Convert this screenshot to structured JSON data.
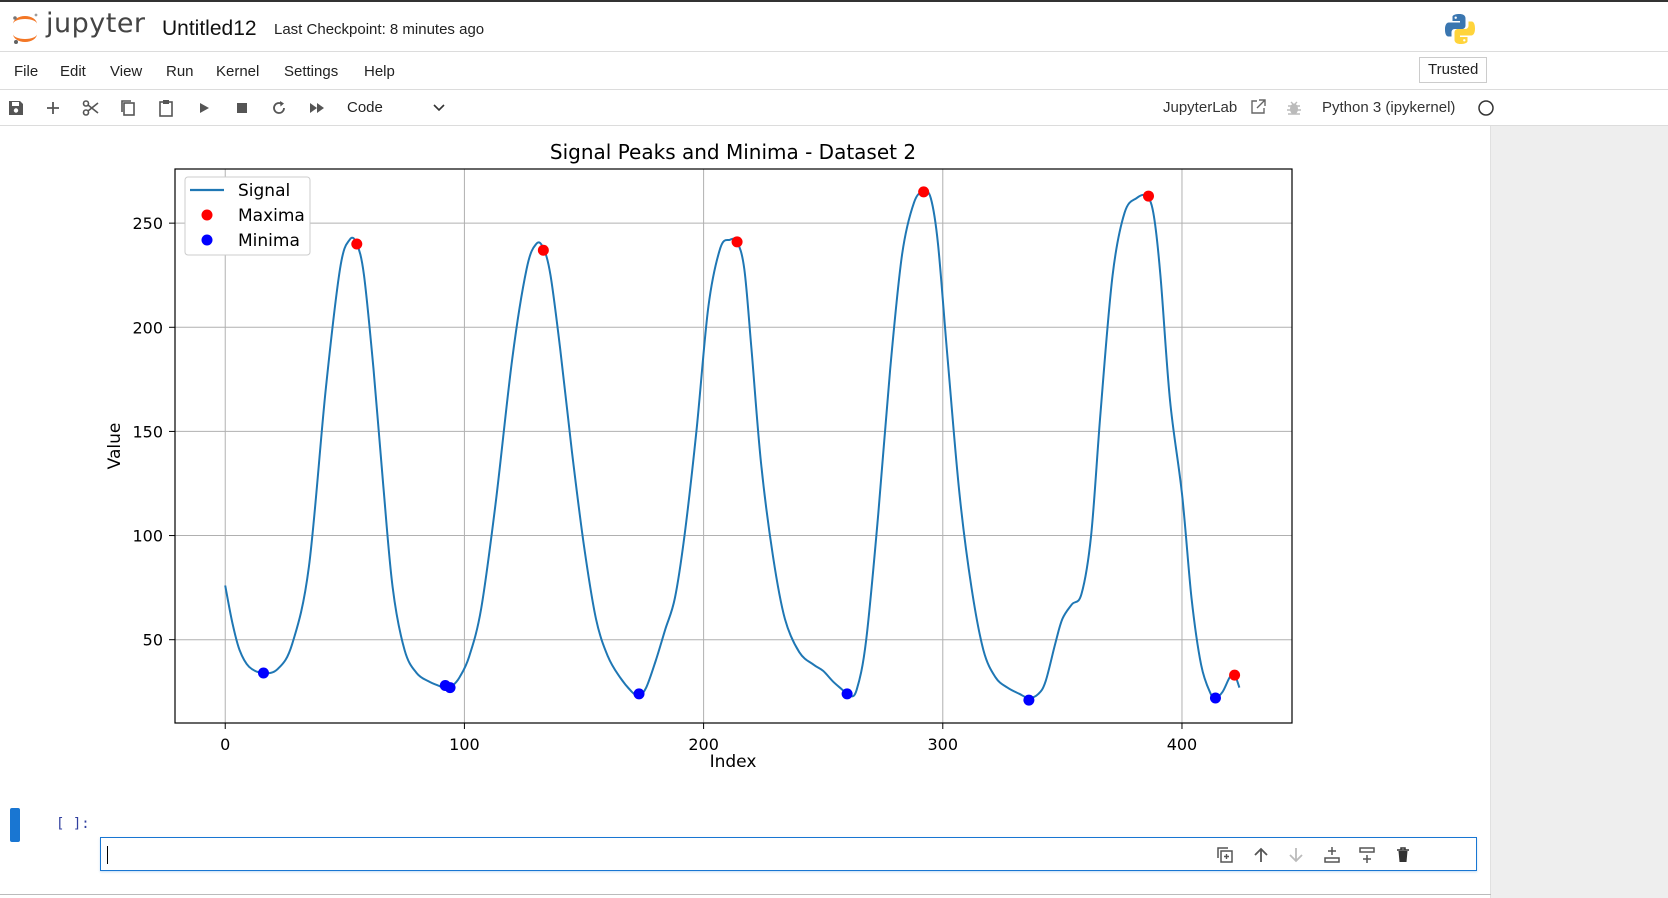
{
  "header": {
    "logo_text": "jupyter",
    "notebook_title": "Untitled12",
    "checkpoint": "Last Checkpoint: 8 minutes ago"
  },
  "menu": {
    "items": [
      "File",
      "Edit",
      "View",
      "Run",
      "Kernel",
      "Settings",
      "Help"
    ],
    "trusted": "Trusted"
  },
  "toolbar": {
    "buttons": [
      "save-icon",
      "add-icon",
      "cut-icon",
      "copy-icon",
      "paste-icon",
      "run-icon",
      "stop-icon",
      "restart-icon",
      "fast-forward-icon"
    ],
    "cell_type": "Code",
    "jupyterlab_link": "JupyterLab",
    "kernel": "Python 3 (ipykernel)"
  },
  "cell": {
    "prompt": "[ ]:",
    "value": ""
  },
  "chart_data": {
    "type": "line",
    "title": "Signal Peaks and Minima - Dataset 2",
    "xlabel": "Index",
    "ylabel": "Value",
    "xlim": [
      -21,
      446
    ],
    "ylim": [
      10,
      276
    ],
    "xticks": [
      0,
      100,
      200,
      300,
      400
    ],
    "yticks": [
      50,
      100,
      150,
      200,
      250
    ],
    "grid": true,
    "legend_position": "upper left",
    "colors": {
      "signal": "#1f77b4",
      "maxima": "#ff0000",
      "minima": "#0000ff"
    },
    "series": [
      {
        "name": "Signal",
        "kind": "line",
        "x": [
          0,
          3,
          6,
          10,
          16,
          22,
          28,
          35,
          42,
          48,
          52,
          55,
          58,
          62,
          66,
          70,
          75,
          80,
          85,
          89,
          92,
          95,
          98,
          102,
          107,
          113,
          120,
          126,
          130,
          133,
          136,
          140,
          145,
          150,
          155,
          160,
          165,
          170,
          173,
          176,
          180,
          184,
          188,
          192,
          197,
          202,
          207,
          211,
          214,
          217,
          220,
          224,
          229,
          234,
          240,
          246,
          250,
          254,
          258,
          261,
          264,
          268,
          273,
          278,
          283,
          288,
          292,
          295,
          298,
          302,
          307,
          312,
          317,
          322,
          327,
          332,
          336,
          340,
          343,
          347,
          350,
          354,
          358,
          362,
          366,
          371,
          376,
          381,
          385,
          388,
          391,
          395,
          400,
          404,
          408,
          412,
          414,
          417,
          420,
          422,
          424
        ],
        "y": [
          76,
          58,
          45,
          37,
          34,
          36,
          48,
          85,
          170,
          228,
          242,
          240,
          225,
          180,
          125,
          75,
          45,
          34,
          30,
          28,
          27,
          28,
          32,
          42,
          65,
          115,
          185,
          228,
          240,
          238,
          225,
          190,
          140,
          95,
          60,
          42,
          32,
          25,
          23,
          27,
          40,
          55,
          70,
          100,
          150,
          210,
          238,
          242,
          241,
          228,
          190,
          135,
          90,
          60,
          44,
          38,
          35,
          30,
          26,
          23,
          26,
          50,
          110,
          180,
          235,
          260,
          265,
          262,
          240,
          185,
          120,
          75,
          45,
          32,
          27,
          24,
          22,
          24,
          30,
          48,
          60,
          67,
          72,
          100,
          160,
          225,
          255,
          262,
          263,
          255,
          225,
          165,
          120,
          70,
          38,
          24,
          22,
          25,
          32,
          33,
          27
        ]
      },
      {
        "name": "Maxima",
        "kind": "scatter",
        "x": [
          55,
          133,
          214,
          292,
          386,
          422
        ],
        "y": [
          240,
          237,
          241,
          265,
          263,
          33
        ]
      },
      {
        "name": "Minima",
        "kind": "scatter",
        "x": [
          16,
          92,
          94,
          173,
          260,
          336,
          414
        ],
        "y": [
          34,
          28,
          27,
          24,
          24,
          21,
          22
        ]
      }
    ]
  }
}
